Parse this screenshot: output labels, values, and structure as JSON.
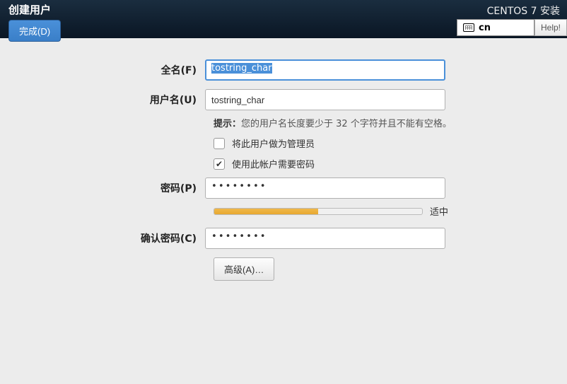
{
  "header": {
    "page_title": "创建用户",
    "done_button": "完成(D)",
    "install_title": "CENTOS 7 安装",
    "keyboard_layout": "cn",
    "help_button": "Help!"
  },
  "form": {
    "fullname": {
      "label": "全名(F)",
      "value": "tostring_char"
    },
    "username": {
      "label": "用户名(U)",
      "value": "tostring_char"
    },
    "hint": {
      "prefix": "提示：",
      "text": "您的用户名长度要少于 32 个字符并且不能有空格。"
    },
    "admin_checkbox": {
      "checked": false,
      "label": "将此用户做为管理员"
    },
    "require_password_checkbox": {
      "checked": true,
      "label": "使用此帐户需要密码"
    },
    "password": {
      "label": "密码(P)",
      "mask": "••••••••"
    },
    "strength": {
      "percent": 50,
      "label": "适中"
    },
    "confirm": {
      "label": "确认密码(C)",
      "mask": "••••••••"
    },
    "advanced_button": "高级(A)…"
  }
}
